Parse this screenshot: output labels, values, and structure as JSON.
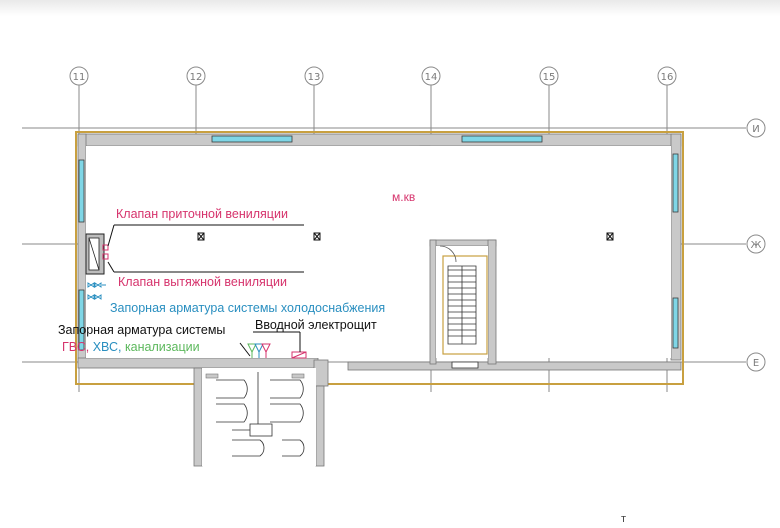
{
  "axes": {
    "vertical": [
      "11",
      "12",
      "13",
      "14",
      "15",
      "16"
    ],
    "horizontal": [
      "И",
      "Ж",
      "Е"
    ]
  },
  "room_label": "м.кв",
  "annotations": {
    "supply_valve": "Клапан приточной вениляции",
    "exhaust_valve": "Клапан вытяжной вениляции",
    "cold_water_valves": "Запорная арматура системы холодоснабжения",
    "shutoff_valves": "Запорная арматура системы",
    "hot_water": "ГВС,",
    "cold_water": "ХВС,",
    "sewerage": "канализации",
    "electrical_panel": "Вводной электрощит"
  },
  "watermark": "т",
  "colors": {
    "magenta": "#d6336c",
    "blue": "#2a8fc0",
    "green": "#5cb85c",
    "wall": "#c9c9c9",
    "outline": "#c8a040",
    "window": "#7fd6e6",
    "grid": "#8a8a8a",
    "black": "#111111"
  }
}
